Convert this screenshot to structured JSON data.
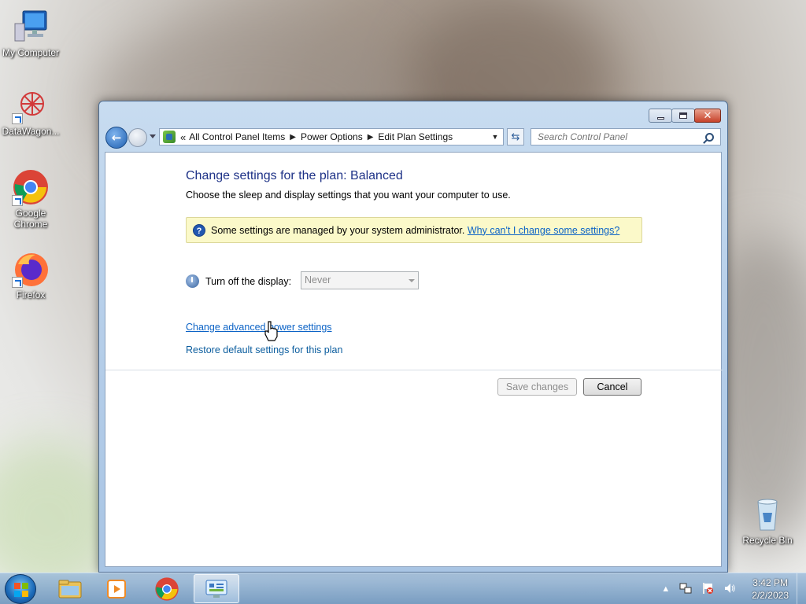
{
  "desktop": {
    "icons": [
      {
        "label": "My Computer"
      },
      {
        "label": "DataWagon..."
      },
      {
        "label": "Google Chrome"
      },
      {
        "label": "Firefox"
      },
      {
        "label": "Recycle Bin"
      }
    ]
  },
  "window": {
    "address": {
      "prefix": "«",
      "crumbs": [
        "All Control Panel Items",
        "Power Options",
        "Edit Plan Settings"
      ]
    },
    "search": {
      "placeholder": "Search Control Panel"
    },
    "content": {
      "title": "Change settings for the plan: Balanced",
      "subtitle": "Choose the sleep and display settings that you want your computer to use.",
      "info_text": "Some settings are managed by your system administrator.",
      "info_link": "Why can't I change some settings?",
      "display_label": "Turn off the display:",
      "display_value": "Never",
      "advanced_link": "Change advanced power settings",
      "restore_link": "Restore default settings for this plan",
      "save_label": "Save changes",
      "cancel_label": "Cancel"
    }
  },
  "taskbar": {
    "time": "3:42 PM",
    "date": "2/2/2023"
  },
  "colors": {
    "title_blue": "#1e3287",
    "link_blue": "#0c63c6",
    "info_bg": "#fbf9c9"
  }
}
